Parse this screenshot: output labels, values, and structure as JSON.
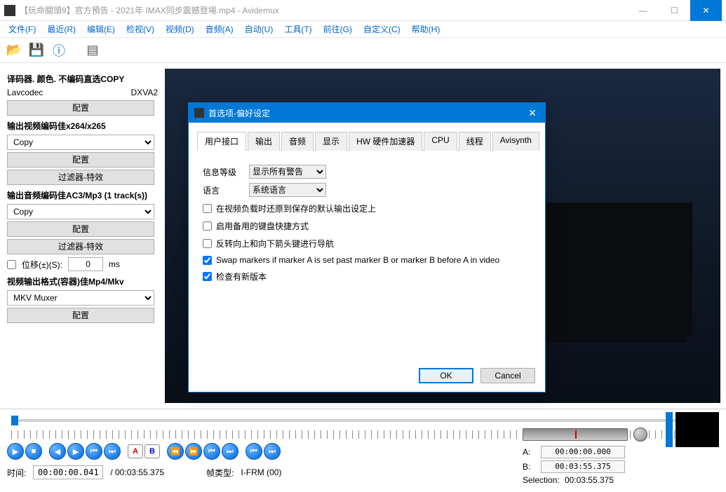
{
  "window": {
    "title": "【玩命關頭9】官方預告 - 2021年 IMAX同步震撼登場.mp4 - Avidemux"
  },
  "menu": {
    "file": "文件(F)",
    "recent": "最近(R)",
    "edit": "编辑(E)",
    "view": "检视(V)",
    "video": "视频(D)",
    "audio": "音频(A)",
    "auto": "自动(U)",
    "tools": "工具(T)",
    "goto": "前往(G)",
    "custom": "自定义(C)",
    "help": "帮助(H)"
  },
  "left": {
    "decoder_title": "译码器. 颜色. 不编码直选COPY",
    "lavcodec": "Lavcodec",
    "dxva2": "DXVA2",
    "config": "配置",
    "video_out_title": "输出视频编码佳x264/x265",
    "copy": "Copy",
    "filters": "过滤器-特效",
    "audio_out_title": "输出音频编码佳AC3/Mp3 (1 track(s))",
    "shift_label": "位移(±)(S):",
    "shift_value": "0",
    "shift_unit": "ms",
    "container_title": "视频输出格式(容器)佳Mp4/Mkv",
    "muxer": "MKV Muxer"
  },
  "dialog": {
    "title": "首选项-偏好设定",
    "tabs": {
      "user": "用户接口",
      "output": "输出",
      "audio": "音频",
      "display": "显示",
      "hw": "HW 硬件加速器",
      "cpu": "CPU",
      "thread": "线程",
      "avisynth": "Avisynth"
    },
    "msg_level_label": "信息等级",
    "msg_level_value": "显示所有警告",
    "lang_label": "语言",
    "lang_value": "系统语言",
    "chk_restore": "在视频负载时还原到保存的默认输出设定上",
    "chk_altkbd": "启用备用的键盘快捷方式",
    "chk_reverse": "反转向上和向下箭头键进行导航",
    "chk_swap": "Swap markers if marker A is set past marker B or marker B before A in video",
    "chk_update": "检查有新版本",
    "ok": "OK",
    "cancel": "Cancel"
  },
  "bottom": {
    "time_label": "时间:",
    "time_value": "00:00:00.041",
    "duration": "/ 00:03:55.375",
    "frame_label": "帧类型:",
    "frame_value": "I-FRM (00)",
    "a_label": "A:",
    "a_value": "00:00:00.000",
    "b_label": "B:",
    "b_value": "00:03:55.375",
    "sel_label": "Selection:",
    "sel_value": "00:03:55.375"
  }
}
